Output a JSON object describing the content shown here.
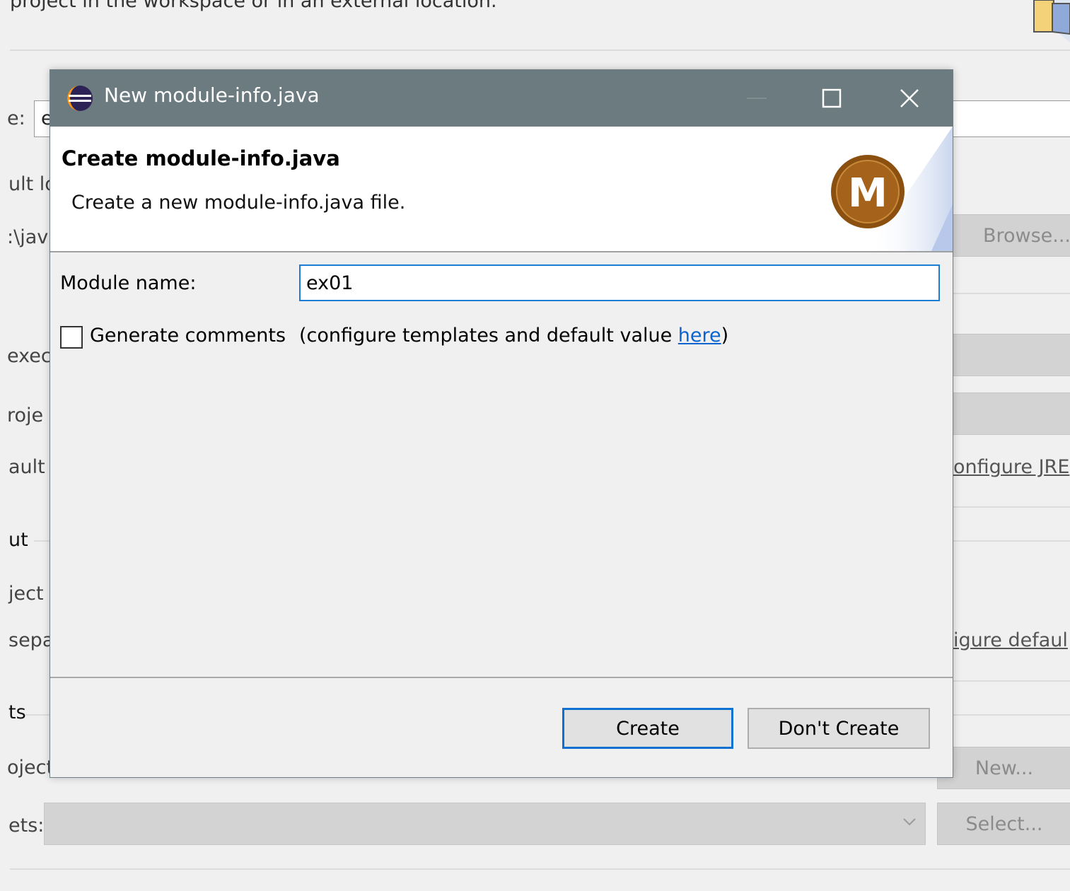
{
  "background": {
    "top_text": "project in the workspace or in an external location.",
    "labels": {
      "name_label": "e:",
      "name_value": "e",
      "default_location": "ult lo",
      "location_value": ":\\jav",
      "browse_button": "Browse...",
      "execution": "exec",
      "project": "roje",
      "default": "ault",
      "configure_jre": "onfigure JRE",
      "layout": "ut",
      "project2": "ject",
      "separate": "sepa",
      "configure_default": "igure defaul",
      "working_sets": "ts",
      "project3": "oject",
      "sets": "ets:",
      "new_button": "New...",
      "select_button": "Select..."
    }
  },
  "dialog": {
    "title": "New module-info.java",
    "banner": {
      "title": "Create module-info.java",
      "description": "Create a new module-info.java file."
    },
    "module_name": {
      "label": "Module name:",
      "value": "ex01"
    },
    "generate_comments": {
      "label": "Generate comments",
      "checked": false,
      "hint_prefix": "(configure templates and default value ",
      "hint_link": "here",
      "hint_suffix": ")"
    },
    "buttons": {
      "create": "Create",
      "dont_create": "Don't Create"
    },
    "banner_logo_letter": "M",
    "colors": {
      "titlebar": "#6c7b7f",
      "focus_border": "#1a7fd4",
      "link": "#0b63cf",
      "logo": "#8b4f10"
    }
  }
}
